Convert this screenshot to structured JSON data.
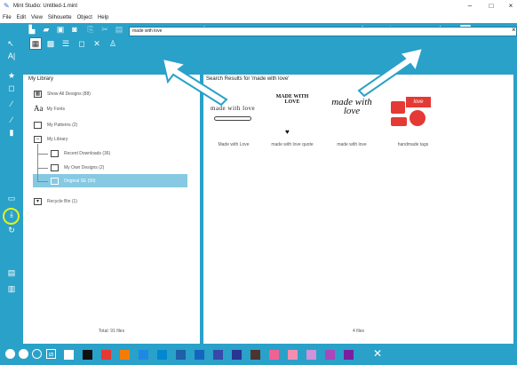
{
  "window": {
    "title": "Mint Studio: Untitled-1.mint",
    "controls": [
      "–",
      "□",
      "×"
    ]
  },
  "menu": [
    "File",
    "Edit",
    "View",
    "Silhouette",
    "Object",
    "Help"
  ],
  "search": {
    "value": "made with love",
    "clear": "×"
  },
  "library": {
    "header": "My Library",
    "items": [
      {
        "label": "Show All Designs (88)"
      },
      {
        "label": "My Fonts"
      },
      {
        "label": "My Patterns (2)"
      },
      {
        "label": "My Library"
      },
      {
        "label": "Recent Downloads (36)"
      },
      {
        "label": "My Own Designs (2)"
      },
      {
        "label": "Original SE (50)"
      },
      {
        "label": "Recycle Bin (1)"
      }
    ],
    "fonts_glyph": "Aa",
    "total": "Total: 91 files"
  },
  "results": {
    "header": "Search Results for 'made with love'",
    "total": "4 files",
    "items": [
      {
        "name": "Made with Love",
        "art_text": "made with love"
      },
      {
        "name": "made with love quote",
        "art_text": "MADE WITH LOVE"
      },
      {
        "name": "made with love",
        "art_text": "made with love"
      },
      {
        "name": "handmade tags",
        "art_text": "love"
      }
    ]
  },
  "colors": {
    "accent": "#2aa1c8",
    "selected": "#86c9e2",
    "highlight_ring": "#e4f21c",
    "palette": [
      "#ffffff",
      "#111111",
      "#e53935",
      "#f57c00",
      "#1e88e5",
      "#0288d1",
      "#1e5fa8",
      "#1565c0",
      "#3949ab",
      "#283593",
      "#4e342e",
      "#f06292",
      "#f48fb1",
      "#ce93d8",
      "#ab47bc",
      "#7b1fa2"
    ]
  }
}
